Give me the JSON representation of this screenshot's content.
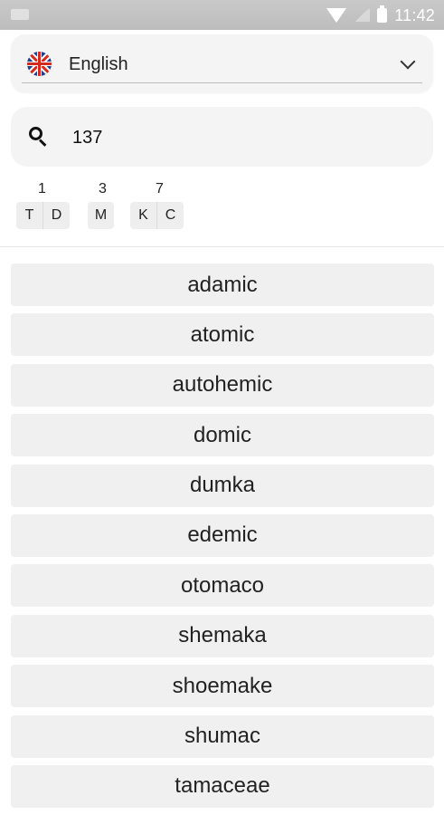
{
  "status_bar": {
    "time": "11:42"
  },
  "language": {
    "label": "English",
    "flag_icon": "uk-flag-icon"
  },
  "search": {
    "value": "137"
  },
  "digits": [
    {
      "digit": "1",
      "letters": [
        "T",
        "D"
      ]
    },
    {
      "digit": "3",
      "letters": [
        "M"
      ]
    },
    {
      "digit": "7",
      "letters": [
        "K",
        "C"
      ]
    }
  ],
  "results": [
    "adamic",
    "atomic",
    "autohemic",
    "domic",
    "dumka",
    "edemic",
    "otomaco",
    "shemaka",
    "shoemake",
    "shumac",
    "tamaceae"
  ],
  "colors": {
    "status_bar": "#bdbdbd",
    "card": "#f4f4f4",
    "item": "#f0f0f0",
    "text": "#222222"
  }
}
